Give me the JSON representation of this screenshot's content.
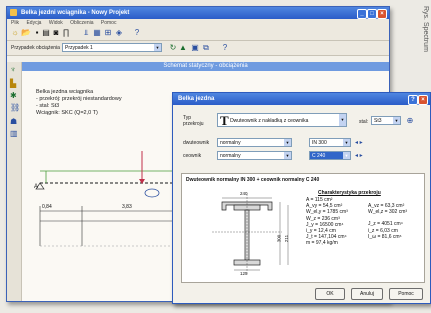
{
  "main": {
    "title": "Belka jezdni wciągnika - Nowy Projekt",
    "menu": [
      "Plik",
      "Edycja",
      "Widok",
      "Obliczenia",
      "Pomoc"
    ],
    "case_label": "Przypadek obciążenia",
    "case_value": "Przypadek 1",
    "panel_title": "Schemat statyczny - obciążenia",
    "info_lines": [
      "Belka jezdna wciągnika",
      "- przekrój: przekrój niestandardowy",
      "- stal: St3",
      "Wciągnik: SKC (Q=2,0 T)"
    ],
    "node_a": "A",
    "dims": [
      "0,84",
      "3,83"
    ]
  },
  "dialog": {
    "title": "Belka jezdna",
    "type_label": "Typ\nprzekroju",
    "type_value": "Dwuteownik z nakładką z ceownika",
    "steel_label": "stal:",
    "steel_value": "St3",
    "dwuteownik_label": "dwuteownik",
    "dwuteownik_kind": "normalny",
    "dwuteownik_size": "IN 300",
    "ceownik_label": "ceownik",
    "ceownik_kind": "normalny",
    "ceownik_size": "C 240",
    "section_title": "Dwuteownik normalny IN 300 + ceownik normalny C 240",
    "props_title": "Charakterystyka przekroju",
    "props_left": [
      "A = 115 cm²",
      "A_vy = 54,5 cm²",
      "W_el,y = 1785 cm³",
      "W_z = 236 cm³",
      "J_y = 16500 cm⁴",
      "i_y = 12,4 cm",
      "J_t = 147,104 cm⁴",
      "m = 97,4 kg/m"
    ],
    "props_right": [
      "A_vz = 63,3 cm²",
      "W_el,z = 302 cm³",
      "",
      "J_z = 4051 cm⁴",
      "i_z = 6,03 cm",
      "I_ω = 81,6 cm⁶"
    ],
    "dim_labels": [
      "240",
      "125",
      "300",
      "211"
    ],
    "ok": "OK",
    "cancel": "Anuluj",
    "help": "Pomoc"
  },
  "side_caption": "Rys. Spectrum"
}
